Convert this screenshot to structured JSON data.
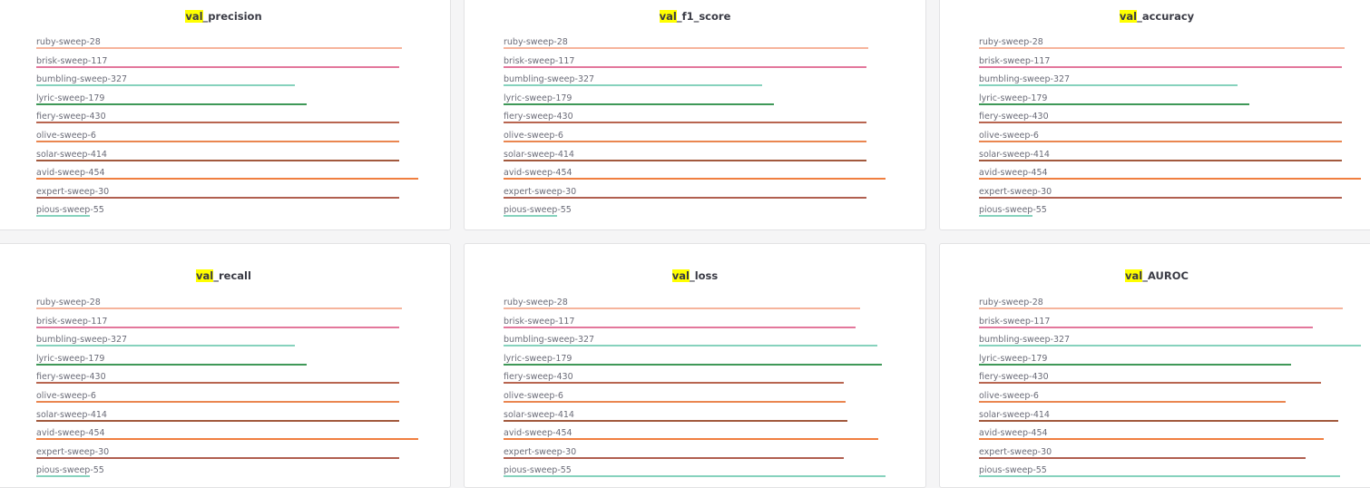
{
  "highlight": "val",
  "colors": {
    "ruby-sweep-28": "#f6b49c",
    "brisk-sweep-117": "#e3779c",
    "bumbling-sweep-327": "#86d2bd",
    "lyric-sweep-179": "#3f9858",
    "fiery-sweep-430": "#b86550",
    "olive-sweep-6": "#ea8650",
    "solar-sweep-414": "#a2593d",
    "avid-sweep-454": "#f07f40",
    "expert-sweep-30": "#b05f50",
    "pious-sweep-55": "#86d2bd"
  },
  "chart_data": [
    {
      "type": "bar",
      "orientation": "horizontal",
      "title": "val_precision",
      "title_prefix": "val",
      "title_suffix": "_precision",
      "categories": [
        "ruby-sweep-28",
        "brisk-sweep-117",
        "bumbling-sweep-327",
        "lyric-sweep-179",
        "fiery-sweep-430",
        "olive-sweep-6",
        "solar-sweep-414",
        "avid-sweep-454",
        "expert-sweep-30",
        "pious-sweep-55"
      ],
      "values": [
        0.957,
        0.95,
        0.677,
        0.708,
        0.95,
        0.95,
        0.95,
        1.0,
        0.95,
        0.14
      ],
      "xlim": [
        0,
        1.0
      ]
    },
    {
      "type": "bar",
      "orientation": "horizontal",
      "title": "val_f1_score",
      "title_prefix": "val",
      "title_suffix": "_f1_score",
      "categories": [
        "ruby-sweep-28",
        "brisk-sweep-117",
        "bumbling-sweep-327",
        "lyric-sweep-179",
        "fiery-sweep-430",
        "olive-sweep-6",
        "solar-sweep-414",
        "avid-sweep-454",
        "expert-sweep-30",
        "pious-sweep-55"
      ],
      "values": [
        0.955,
        0.95,
        0.677,
        0.708,
        0.95,
        0.95,
        0.95,
        1.0,
        0.95,
        0.14
      ],
      "xlim": [
        0,
        1.0
      ]
    },
    {
      "type": "bar",
      "orientation": "horizontal",
      "title": "val_accuracy",
      "title_prefix": "val",
      "title_suffix": "_accuracy",
      "categories": [
        "ruby-sweep-28",
        "brisk-sweep-117",
        "bumbling-sweep-327",
        "lyric-sweep-179",
        "fiery-sweep-430",
        "olive-sweep-6",
        "solar-sweep-414",
        "avid-sweep-454",
        "expert-sweep-30",
        "pious-sweep-55"
      ],
      "values": [
        0.957,
        0.95,
        0.677,
        0.708,
        0.95,
        0.95,
        0.95,
        1.0,
        0.95,
        0.14
      ],
      "xlim": [
        0,
        1.0
      ]
    },
    {
      "type": "bar",
      "orientation": "horizontal",
      "title": "val_recall",
      "title_prefix": "val",
      "title_suffix": "_recall",
      "categories": [
        "ruby-sweep-28",
        "brisk-sweep-117",
        "bumbling-sweep-327",
        "lyric-sweep-179",
        "fiery-sweep-430",
        "olive-sweep-6",
        "solar-sweep-414",
        "avid-sweep-454",
        "expert-sweep-30",
        "pious-sweep-55"
      ],
      "values": [
        0.957,
        0.95,
        0.677,
        0.708,
        0.95,
        0.95,
        0.95,
        1.0,
        0.95,
        0.14
      ],
      "xlim": [
        0,
        1.0
      ]
    },
    {
      "type": "bar",
      "orientation": "horizontal",
      "title": "val_loss",
      "title_prefix": "val",
      "title_suffix": "_loss",
      "categories": [
        "ruby-sweep-28",
        "brisk-sweep-117",
        "bumbling-sweep-327",
        "lyric-sweep-179",
        "fiery-sweep-430",
        "olive-sweep-6",
        "solar-sweep-414",
        "avid-sweep-454",
        "expert-sweep-30",
        "pious-sweep-55"
      ],
      "values": [
        0.933,
        0.922,
        0.978,
        0.99,
        0.89,
        0.895,
        0.9,
        0.98,
        0.89,
        1.0
      ],
      "xlim": [
        0,
        1.0
      ]
    },
    {
      "type": "bar",
      "orientation": "horizontal",
      "title": "val_AUROC",
      "title_prefix": "val",
      "title_suffix": "_AUROC",
      "categories": [
        "ruby-sweep-28",
        "brisk-sweep-117",
        "bumbling-sweep-327",
        "lyric-sweep-179",
        "fiery-sweep-430",
        "olive-sweep-6",
        "solar-sweep-414",
        "avid-sweep-454",
        "expert-sweep-30",
        "pious-sweep-55"
      ],
      "values": [
        0.953,
        0.874,
        1.0,
        0.817,
        0.895,
        0.802,
        0.94,
        0.903,
        0.855,
        0.945
      ],
      "xlim": [
        0,
        1.0
      ]
    }
  ]
}
